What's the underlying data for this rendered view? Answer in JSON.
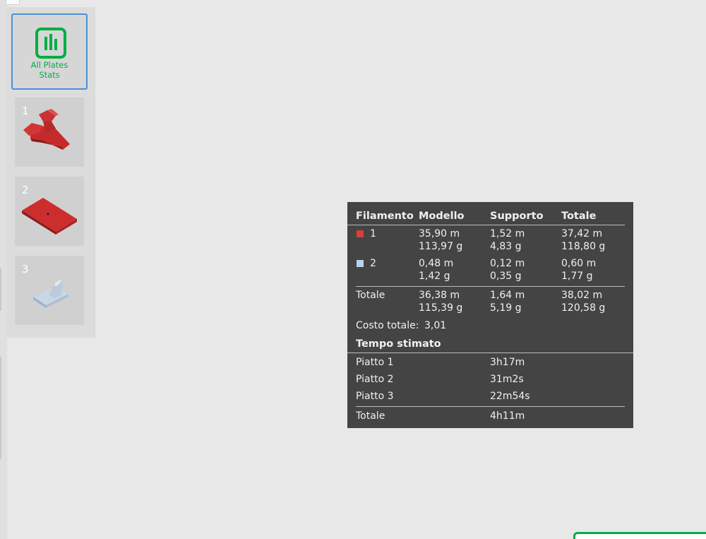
{
  "sidebar": {
    "all_plates_label_line1": "All Plates",
    "all_plates_label_line2": "Stats",
    "plates": [
      {
        "number": "1"
      },
      {
        "number": "2"
      },
      {
        "number": "3"
      }
    ]
  },
  "stats": {
    "headers": {
      "filament": "Filamento",
      "model": "Modello",
      "support": "Supporto",
      "total": "Totale"
    },
    "filaments": [
      {
        "id": "1",
        "color": "#d93c3c",
        "model_len": "35,90 m",
        "model_wt": "113,97 g",
        "support_len": "1,52 m",
        "support_wt": "4,83 g",
        "total_len": "37,42 m",
        "total_wt": "118,80 g"
      },
      {
        "id": "2",
        "color": "#b8d2ec",
        "model_len": "0,48 m",
        "model_wt": "1,42 g",
        "support_len": "0,12 m",
        "support_wt": "0,35 g",
        "total_len": "0,60 m",
        "total_wt": "1,77 g"
      }
    ],
    "totals": {
      "label": "Totale",
      "model_len": "36,38 m",
      "model_wt": "115,39 g",
      "support_len": "1,64 m",
      "support_wt": "5,19 g",
      "total_len": "38,02 m",
      "total_wt": "120,58 g"
    },
    "cost_label": "Costo totale:",
    "cost_value": "3,01",
    "time_title": "Tempo stimato",
    "plates_time": [
      {
        "label": "Piatto 1",
        "value": "3h17m"
      },
      {
        "label": "Piatto 2",
        "value": "31m2s"
      },
      {
        "label": "Piatto 3",
        "value": "22m54s"
      }
    ],
    "time_total_label": "Totale",
    "time_total_value": "4h11m"
  },
  "colors": {
    "accent": "#00ae42",
    "selection": "#4a90d9",
    "panel_bg": "#444444"
  }
}
